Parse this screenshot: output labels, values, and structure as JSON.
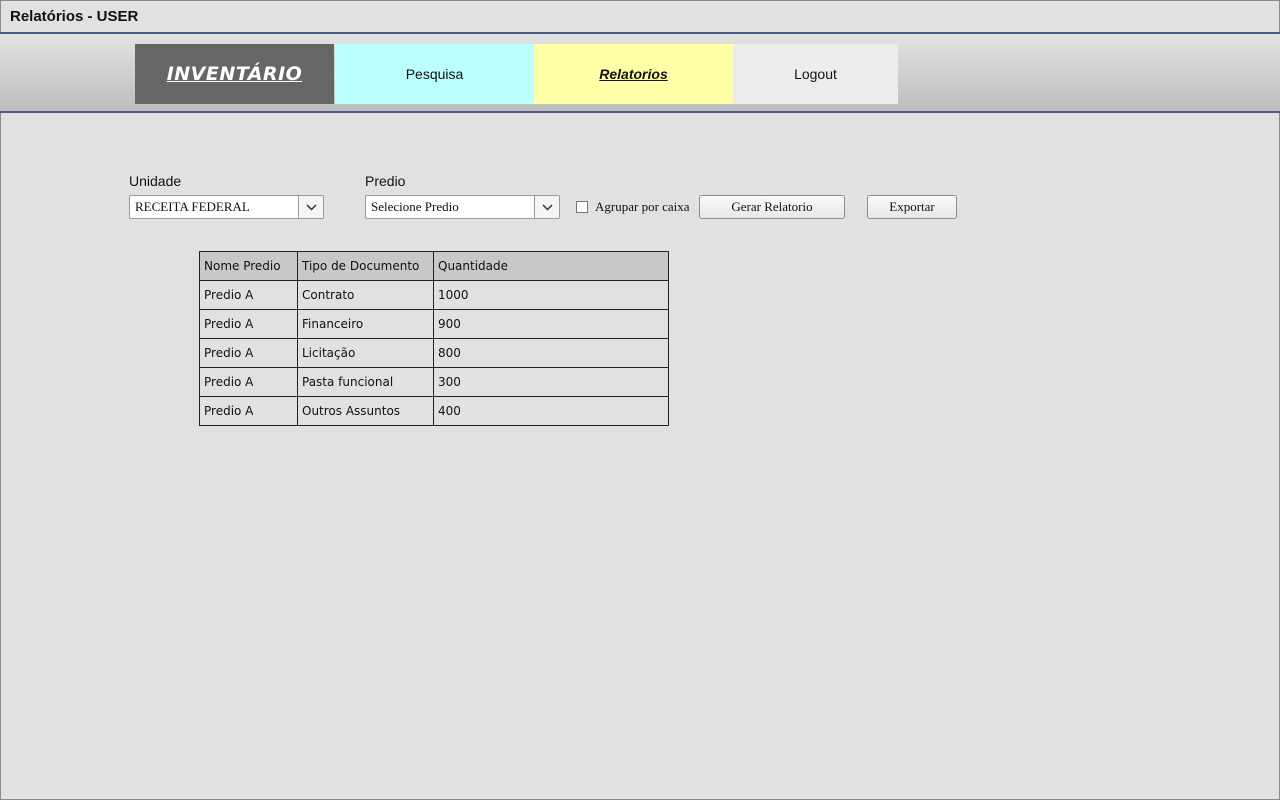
{
  "window": {
    "title": "Relatórios - USER"
  },
  "nav": {
    "logo": "INVENTÁRIO",
    "items": [
      {
        "label": "Pesquisa",
        "color": "#bbffff"
      },
      {
        "label": "Relatorios",
        "color": "#ffffa8",
        "active": true
      },
      {
        "label": "Logout",
        "color": "#ececec"
      }
    ]
  },
  "filters": {
    "unidade": {
      "label": "Unidade",
      "value": "RECEITA FEDERAL"
    },
    "predio": {
      "label": "Predio",
      "value": "Selecione Predio"
    },
    "agrupar": {
      "label": "Agrupar por caixa",
      "checked": false
    },
    "gerar_label": "Gerar Relatorio",
    "exportar_label": "Exportar"
  },
  "table": {
    "headers": [
      "Nome Predio",
      "Tipo de Documento",
      "Quantidade"
    ],
    "rows": [
      [
        "Predio A",
        "Contrato",
        "1000"
      ],
      [
        "Predio A",
        "Financeiro",
        "900"
      ],
      [
        "Predio A",
        "Licitação",
        "800"
      ],
      [
        "Predio A",
        "Pasta funcional",
        "300"
      ],
      [
        "Predio A",
        "Outros Assuntos",
        "400"
      ]
    ]
  }
}
